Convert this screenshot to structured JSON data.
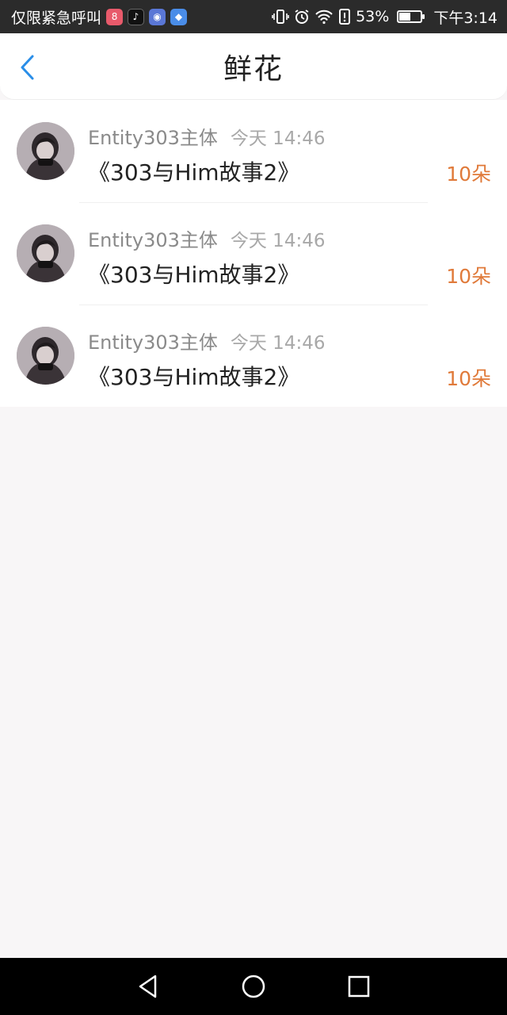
{
  "status_bar": {
    "carrier_text": "仅限紧急呼叫",
    "app_icons": [
      {
        "name": "app-icon-red",
        "glyph": "8"
      },
      {
        "name": "tiktok-icon",
        "glyph": "♪"
      },
      {
        "name": "baidu-icon",
        "glyph": "◉"
      },
      {
        "name": "compass-icon",
        "glyph": "◆"
      }
    ],
    "battery_percent": "53%",
    "battery_level": 0.53,
    "time": "下午3:14"
  },
  "header": {
    "title": "鲜花"
  },
  "flowers": [
    {
      "author": "Entity303主体",
      "time": "今天 14:46",
      "work": "《303与Him故事2》",
      "count": "10朵"
    },
    {
      "author": "Entity303主体",
      "time": "今天 14:46",
      "work": "《303与Him故事2》",
      "count": "10朵"
    },
    {
      "author": "Entity303主体",
      "time": "今天 14:46",
      "work": "《303与Him故事2》",
      "count": "10朵"
    }
  ],
  "colors": {
    "accent_blue": "#2a8ee8",
    "count_orange": "#e07a3a",
    "background": "#f8f6f7"
  }
}
